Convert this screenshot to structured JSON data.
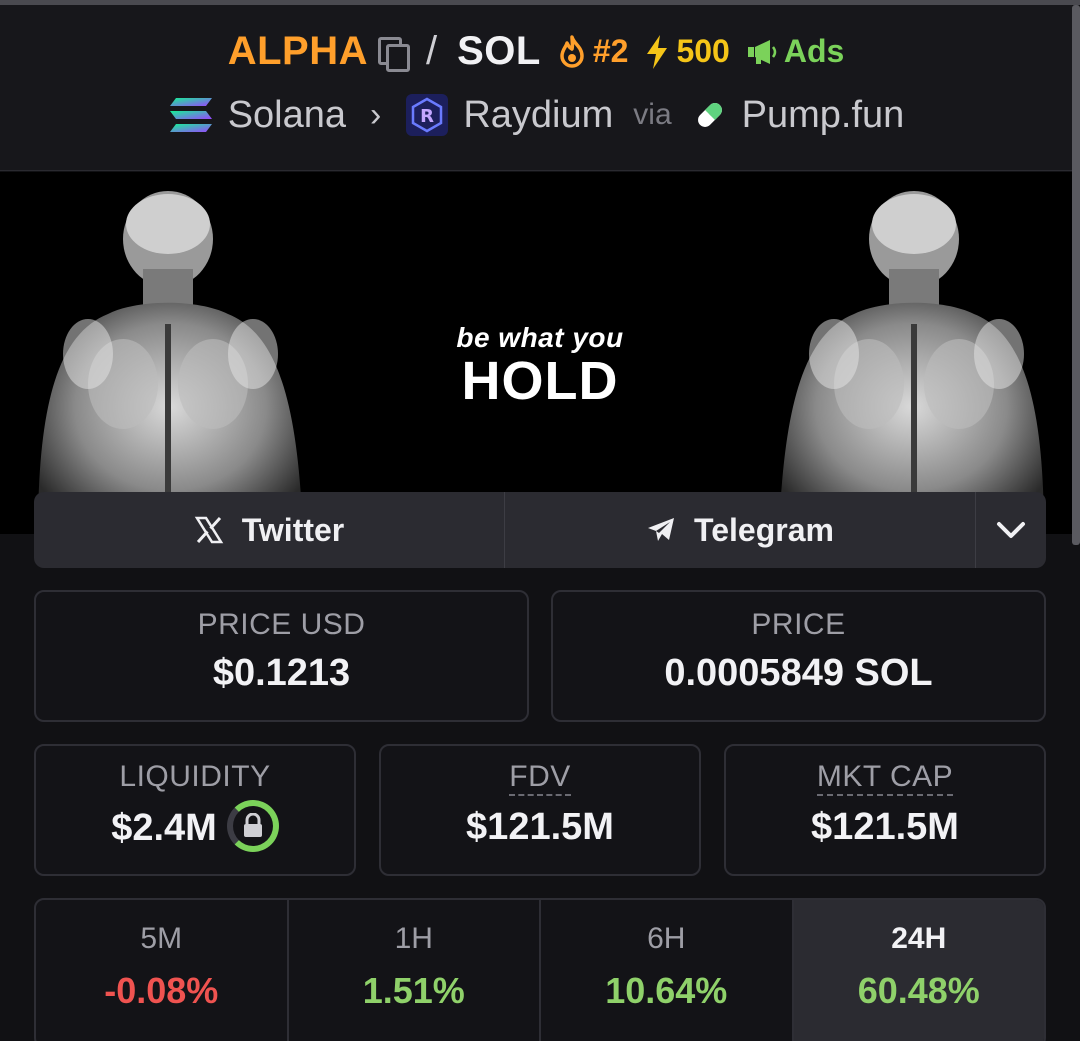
{
  "pair": {
    "base_symbol": "ALPHA",
    "separator": "/",
    "quote_symbol": "SOL",
    "trending_rank": "#2",
    "boost_count": "500",
    "ads_label": "Ads"
  },
  "route": {
    "chain": "Solana",
    "dex": "Raydium",
    "via_label": "via",
    "launchpad": "Pump.fun"
  },
  "banner": {
    "tagline_small": "be what you",
    "tagline_big": "HOLD"
  },
  "socials": {
    "twitter_label": "Twitter",
    "telegram_label": "Telegram"
  },
  "stats": {
    "price_usd": {
      "label": "PRICE USD",
      "value": "$0.1213"
    },
    "price_native": {
      "label": "PRICE",
      "value": "0.0005849 SOL"
    },
    "liquidity": {
      "label": "LIQUIDITY",
      "value": "$2.4M"
    },
    "fdv": {
      "label": "FDV",
      "value": "$121.5M"
    },
    "market_cap": {
      "label": "MKT CAP",
      "value": "$121.5M"
    }
  },
  "changes": [
    {
      "label": "5M",
      "value": "-0.08%",
      "direction": "negative"
    },
    {
      "label": "1H",
      "value": "1.51%",
      "direction": "positive"
    },
    {
      "label": "6H",
      "value": "10.64%",
      "direction": "positive"
    },
    {
      "label": "24H",
      "value": "60.48%",
      "direction": "positive",
      "active": true
    }
  ],
  "colors": {
    "base_symbol": "#ff9f2b",
    "trending": "#ff9f2b",
    "boost": "#f5c518",
    "ads": "#7bd25a",
    "negative": "#ef5350",
    "positive": "#8fd16a"
  },
  "icons": {
    "copy": "copy-icon",
    "trending": "fire-icon",
    "boost": "lightning-icon",
    "ads": "megaphone-icon",
    "chain": "solana-icon",
    "dex": "raydium-icon",
    "launchpad": "pill-icon",
    "twitter": "x-icon",
    "telegram": "telegram-icon",
    "more": "chevron-down-icon",
    "liquidity_lock": "lock-icon"
  }
}
